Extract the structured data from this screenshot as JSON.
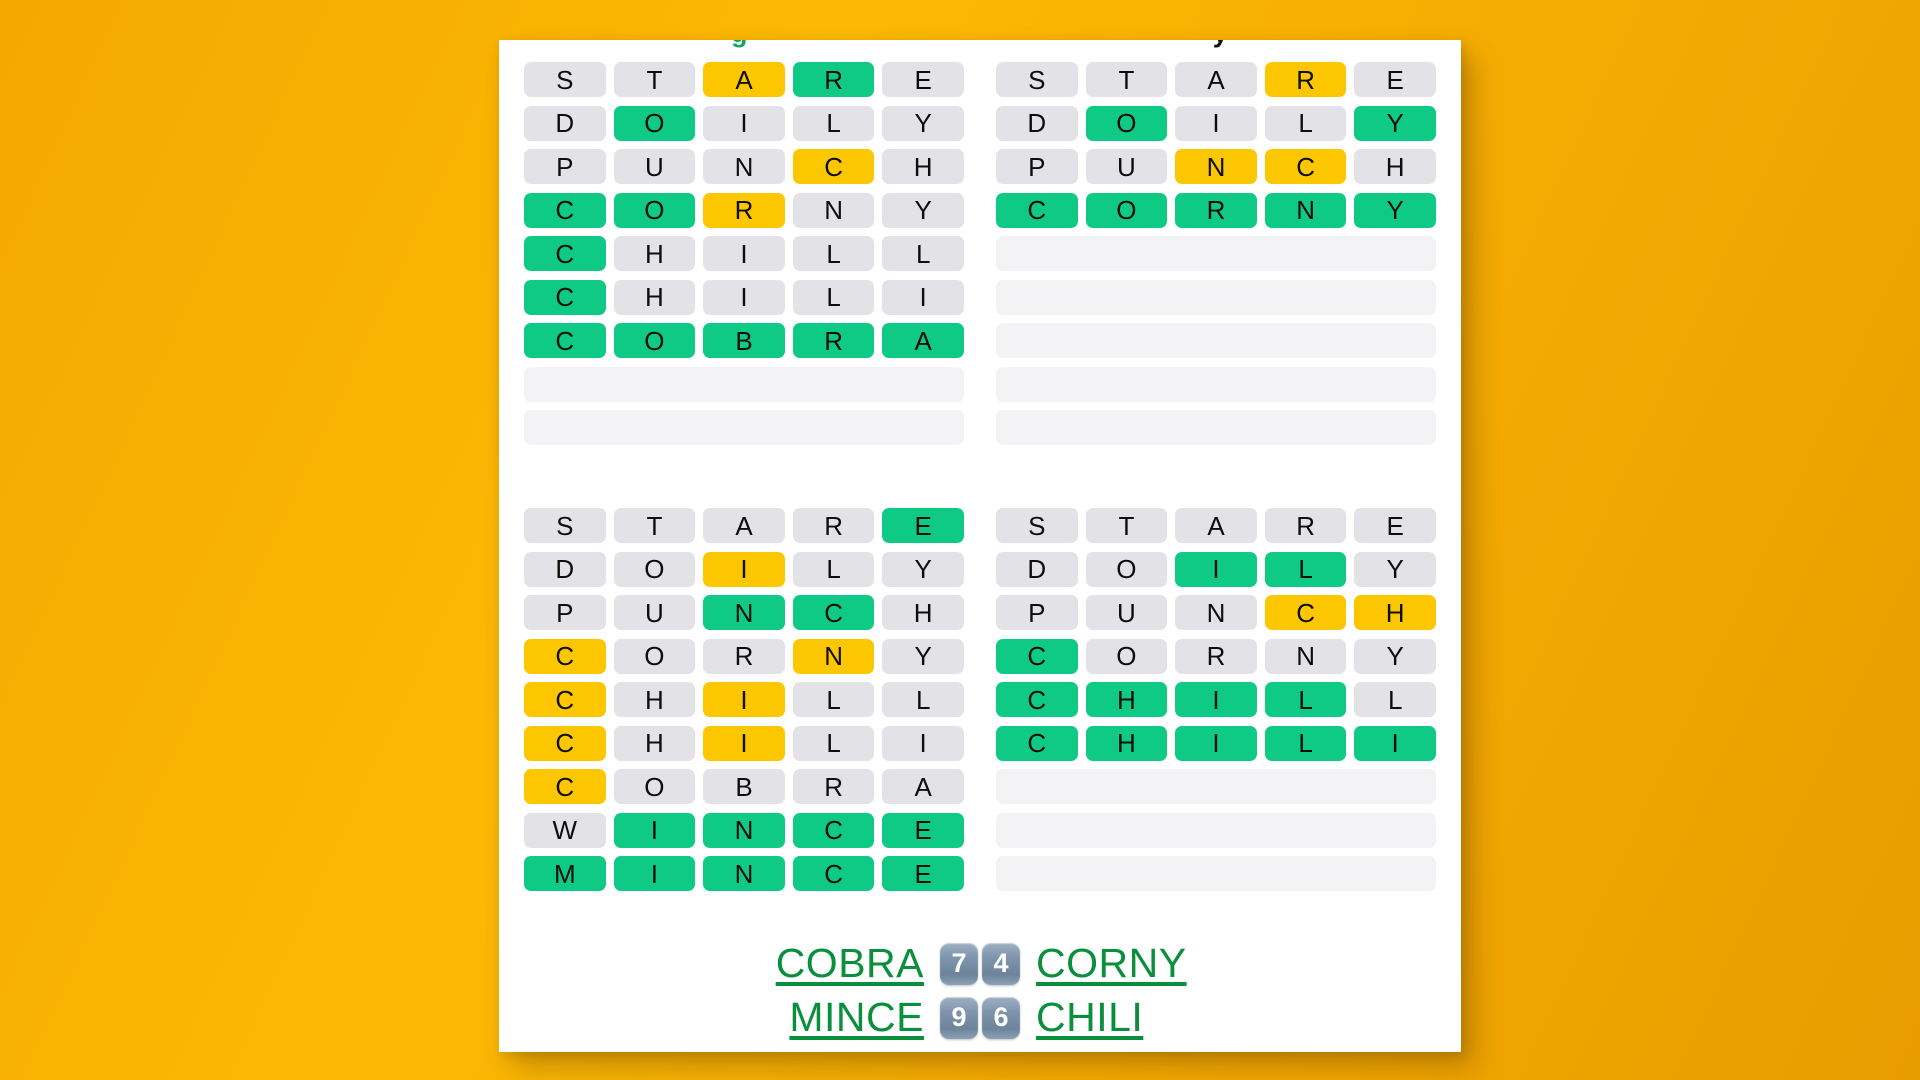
{
  "page": {
    "background_color": "#f5a800",
    "card_background": "#ffffff"
  },
  "colors": {
    "correct_green": "#0fca84",
    "present_yellow": "#fdc700",
    "absent_gray": "#e3e3e7",
    "empty_row": "#f3f3f5",
    "answer_link": "#0a8f3c",
    "badge": "#7f95ad"
  },
  "clipped_header": {
    "left_fragment": "g",
    "right_fragment": "y"
  },
  "quadrants": [
    {
      "id": "top-left",
      "answer": "COBRA",
      "guess_count": 7,
      "rows": [
        {
          "letters": [
            "S",
            "T",
            "A",
            "R",
            "E"
          ],
          "states": [
            "absent",
            "absent",
            "present",
            "correct",
            "absent"
          ]
        },
        {
          "letters": [
            "D",
            "O",
            "I",
            "L",
            "Y"
          ],
          "states": [
            "absent",
            "correct",
            "absent",
            "absent",
            "absent"
          ]
        },
        {
          "letters": [
            "P",
            "U",
            "N",
            "C",
            "H"
          ],
          "states": [
            "absent",
            "absent",
            "absent",
            "present",
            "absent"
          ]
        },
        {
          "letters": [
            "C",
            "O",
            "R",
            "N",
            "Y"
          ],
          "states": [
            "correct",
            "correct",
            "present",
            "absent",
            "absent"
          ]
        },
        {
          "letters": [
            "C",
            "H",
            "I",
            "L",
            "L"
          ],
          "states": [
            "correct",
            "absent",
            "absent",
            "absent",
            "absent"
          ]
        },
        {
          "letters": [
            "C",
            "H",
            "I",
            "L",
            "I"
          ],
          "states": [
            "correct",
            "absent",
            "absent",
            "absent",
            "absent"
          ]
        },
        {
          "letters": [
            "C",
            "O",
            "B",
            "R",
            "A"
          ],
          "states": [
            "correct",
            "correct",
            "correct",
            "correct",
            "correct"
          ]
        },
        {
          "letters": [
            "",
            "",
            "",
            "",
            ""
          ],
          "states": [
            "empty",
            "empty",
            "empty",
            "empty",
            "empty"
          ]
        },
        {
          "letters": [
            "",
            "",
            "",
            "",
            ""
          ],
          "states": [
            "empty",
            "empty",
            "empty",
            "empty",
            "empty"
          ]
        }
      ]
    },
    {
      "id": "top-right",
      "answer": "CORNY",
      "guess_count": 4,
      "rows": [
        {
          "letters": [
            "S",
            "T",
            "A",
            "R",
            "E"
          ],
          "states": [
            "absent",
            "absent",
            "absent",
            "present",
            "absent"
          ]
        },
        {
          "letters": [
            "D",
            "O",
            "I",
            "L",
            "Y"
          ],
          "states": [
            "absent",
            "correct",
            "absent",
            "absent",
            "correct"
          ]
        },
        {
          "letters": [
            "P",
            "U",
            "N",
            "C",
            "H"
          ],
          "states": [
            "absent",
            "absent",
            "present",
            "present",
            "absent"
          ]
        },
        {
          "letters": [
            "C",
            "O",
            "R",
            "N",
            "Y"
          ],
          "states": [
            "correct",
            "correct",
            "correct",
            "correct",
            "correct"
          ]
        },
        {
          "letters": [
            "",
            "",
            "",
            "",
            ""
          ],
          "states": [
            "empty",
            "empty",
            "empty",
            "empty",
            "empty"
          ]
        },
        {
          "letters": [
            "",
            "",
            "",
            "",
            ""
          ],
          "states": [
            "empty",
            "empty",
            "empty",
            "empty",
            "empty"
          ]
        },
        {
          "letters": [
            "",
            "",
            "",
            "",
            ""
          ],
          "states": [
            "empty",
            "empty",
            "empty",
            "empty",
            "empty"
          ]
        },
        {
          "letters": [
            "",
            "",
            "",
            "",
            ""
          ],
          "states": [
            "empty",
            "empty",
            "empty",
            "empty",
            "empty"
          ]
        },
        {
          "letters": [
            "",
            "",
            "",
            "",
            ""
          ],
          "states": [
            "empty",
            "empty",
            "empty",
            "empty",
            "empty"
          ]
        }
      ]
    },
    {
      "id": "bottom-left",
      "answer": "MINCE",
      "guess_count": 9,
      "rows": [
        {
          "letters": [
            "S",
            "T",
            "A",
            "R",
            "E"
          ],
          "states": [
            "absent",
            "absent",
            "absent",
            "absent",
            "correct"
          ]
        },
        {
          "letters": [
            "D",
            "O",
            "I",
            "L",
            "Y"
          ],
          "states": [
            "absent",
            "absent",
            "present",
            "absent",
            "absent"
          ]
        },
        {
          "letters": [
            "P",
            "U",
            "N",
            "C",
            "H"
          ],
          "states": [
            "absent",
            "absent",
            "correct",
            "correct",
            "absent"
          ]
        },
        {
          "letters": [
            "C",
            "O",
            "R",
            "N",
            "Y"
          ],
          "states": [
            "present",
            "absent",
            "absent",
            "present",
            "absent"
          ]
        },
        {
          "letters": [
            "C",
            "H",
            "I",
            "L",
            "L"
          ],
          "states": [
            "present",
            "absent",
            "present",
            "absent",
            "absent"
          ]
        },
        {
          "letters": [
            "C",
            "H",
            "I",
            "L",
            "I"
          ],
          "states": [
            "present",
            "absent",
            "present",
            "absent",
            "absent"
          ]
        },
        {
          "letters": [
            "C",
            "O",
            "B",
            "R",
            "A"
          ],
          "states": [
            "present",
            "absent",
            "absent",
            "absent",
            "absent"
          ]
        },
        {
          "letters": [
            "W",
            "I",
            "N",
            "C",
            "E"
          ],
          "states": [
            "absent",
            "correct",
            "correct",
            "correct",
            "correct"
          ]
        },
        {
          "letters": [
            "M",
            "I",
            "N",
            "C",
            "E"
          ],
          "states": [
            "correct",
            "correct",
            "correct",
            "correct",
            "correct"
          ]
        }
      ]
    },
    {
      "id": "bottom-right",
      "answer": "CHILI",
      "guess_count": 6,
      "rows": [
        {
          "letters": [
            "S",
            "T",
            "A",
            "R",
            "E"
          ],
          "states": [
            "absent",
            "absent",
            "absent",
            "absent",
            "absent"
          ]
        },
        {
          "letters": [
            "D",
            "O",
            "I",
            "L",
            "Y"
          ],
          "states": [
            "absent",
            "absent",
            "correct",
            "correct",
            "absent"
          ]
        },
        {
          "letters": [
            "P",
            "U",
            "N",
            "C",
            "H"
          ],
          "states": [
            "absent",
            "absent",
            "absent",
            "present",
            "present"
          ]
        },
        {
          "letters": [
            "C",
            "O",
            "R",
            "N",
            "Y"
          ],
          "states": [
            "correct",
            "absent",
            "absent",
            "absent",
            "absent"
          ]
        },
        {
          "letters": [
            "C",
            "H",
            "I",
            "L",
            "L"
          ],
          "states": [
            "correct",
            "correct",
            "correct",
            "correct",
            "absent"
          ]
        },
        {
          "letters": [
            "C",
            "H",
            "I",
            "L",
            "I"
          ],
          "states": [
            "correct",
            "correct",
            "correct",
            "correct",
            "correct"
          ]
        },
        {
          "letters": [
            "",
            "",
            "",
            "",
            ""
          ],
          "states": [
            "empty",
            "empty",
            "empty",
            "empty",
            "empty"
          ]
        },
        {
          "letters": [
            "",
            "",
            "",
            "",
            ""
          ],
          "states": [
            "empty",
            "empty",
            "empty",
            "empty",
            "empty"
          ]
        },
        {
          "letters": [
            "",
            "",
            "",
            "",
            ""
          ],
          "states": [
            "empty",
            "empty",
            "empty",
            "empty",
            "empty"
          ]
        }
      ]
    }
  ],
  "answers": {
    "row1": {
      "left_word": "COBRA",
      "left_count": "7",
      "right_count": "4",
      "right_word": "CORNY"
    },
    "row2": {
      "left_word": "MINCE",
      "left_count": "9",
      "right_count": "6",
      "right_word": "CHILI"
    }
  }
}
